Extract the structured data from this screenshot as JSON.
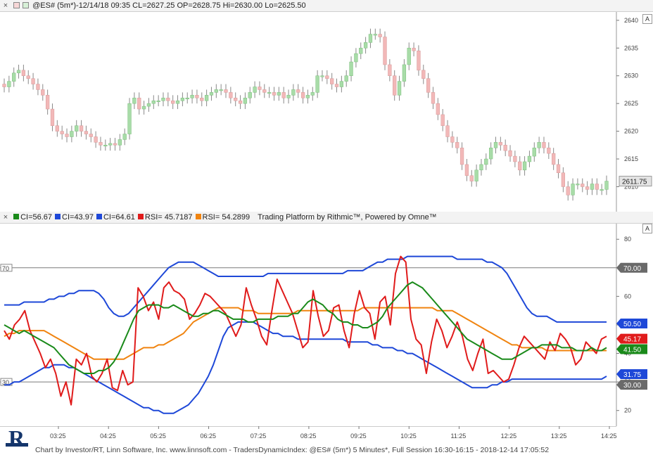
{
  "top_panel": {
    "close_glyph": "×",
    "header_text": "@ES# (5m*)-12/14/18 09:35 CL=2627.25 OP=2628.75 Hi=2630.00 Lo=2625.50",
    "autoscale_label": "A",
    "price_ticks": [
      "2640",
      "2635",
      "2630",
      "2625",
      "2620",
      "2615",
      "2610"
    ],
    "last_price_label": "2611.75"
  },
  "lower_panel": {
    "close_glyph": "×",
    "legend": [
      {
        "text": "CI=56.67",
        "color": "#1a8a1a"
      },
      {
        "text": "CI=43.97",
        "color": "#1e48d8"
      },
      {
        "text": "CI=64.61",
        "color": "#1e48d8"
      },
      {
        "text": "RSI= 45.7187",
        "color": "#e01b1b"
      },
      {
        "text": "RSI= 54.2899",
        "color": "#f08410"
      }
    ],
    "legend_tail": "Trading Platform by Rithmic™, Powered by Omne™",
    "autoscale_label": "A",
    "ticks": [
      "80",
      "70",
      "60",
      "50",
      "40",
      "30",
      "20"
    ],
    "left_level_70": "70",
    "left_level_30": "30",
    "value_tags": [
      {
        "text": "70.00",
        "color": "#6a6a6a"
      },
      {
        "text": "50.50",
        "color": "#1e48d8"
      },
      {
        "text": "45.17",
        "color": "#e01b1b"
      },
      {
        "text": "41.50",
        "color": "#1a8a1a"
      },
      {
        "text": "31.75",
        "color": "#1e48d8"
      },
      {
        "text": "30.00",
        "color": "#6a6a6a"
      }
    ]
  },
  "time_axis": [
    "03:25",
    "04:25",
    "05:25",
    "06:25",
    "07:25",
    "08:25",
    "09:25",
    "10:25",
    "11:25",
    "12:25",
    "13:25",
    "14:25"
  ],
  "footer": "Chart by Investor/RT, Linn Software, Inc. www.linnsoft.com - TradersDynamicIndex: @ES# (5m*) 5 Minutes*, Full Session 16:30-16:15 - 2018-12-14 17:05:52",
  "logo_letter": "R",
  "colors": {
    "bull": "#a8dca8",
    "bear": "#f2b8b8",
    "wick": "#8a8a8a",
    "rsi": "#e01b1b",
    "signal": "#1a8a1a",
    "bands": "#1e48d8",
    "base": "#f08410"
  },
  "chart_data": [
    {
      "type": "candlestick",
      "title": "@ES# (5m*)",
      "ylim": [
        2606,
        2641
      ],
      "close": [
        2628.0,
        2629.0,
        2630.5,
        2631.0,
        2630.0,
        2629.5,
        2628.5,
        2627.5,
        2626.5,
        2624.0,
        2621.0,
        2620.0,
        2619.5,
        2619.0,
        2620.0,
        2621.0,
        2620.0,
        2619.5,
        2619.0,
        2618.0,
        2617.5,
        2617.5,
        2617.8,
        2617.5,
        2618.5,
        2619.5,
        2625.0,
        2626.0,
        2624.0,
        2624.5,
        2625.0,
        2625.5,
        2625.5,
        2626.0,
        2625.5,
        2625.0,
        2625.5,
        2626.0,
        2626.0,
        2626.5,
        2626.0,
        2625.5,
        2626.5,
        2627.0,
        2627.5,
        2627.5,
        2627.0,
        2626.0,
        2625.5,
        2625.0,
        2626.0,
        2627.0,
        2628.0,
        2627.5,
        2627.0,
        2627.0,
        2626.5,
        2627.0,
        2626.0,
        2626.5,
        2627.5,
        2627.0,
        2626.0,
        2626.5,
        2627.0,
        2630.0,
        2630.0,
        2629.5,
        2628.5,
        2628.0,
        2629.0,
        2630.0,
        2632.5,
        2634.0,
        2635.0,
        2636.0,
        2637.5,
        2637.5,
        2637.0,
        2632.0,
        2630.0,
        2626.5,
        2629.0,
        2632.0,
        2635.0,
        2634.5,
        2631.0,
        2629.5,
        2627.0,
        2625.0,
        2623.0,
        2621.0,
        2619.0,
        2618.0,
        2617.0,
        2614.0,
        2612.0,
        2611.0,
        2613.0,
        2614.0,
        2615.0,
        2617.0,
        2618.0,
        2617.5,
        2616.5,
        2615.5,
        2614.5,
        2613.0,
        2614.5,
        2615.5,
        2617.0,
        2618.0,
        2617.0,
        2616.0,
        2614.0,
        2612.5,
        2610.0,
        2608.5,
        2610.5,
        2610.5,
        2610.0,
        2609.5,
        2610.5,
        2609.5,
        2609.5,
        2611.0
      ]
    },
    {
      "type": "line",
      "title": "TradersDynamicIndex",
      "ylim": [
        15,
        84
      ],
      "x": [
        "03:25",
        "04:25",
        "05:25",
        "06:25",
        "07:25",
        "08:25",
        "09:25",
        "10:25",
        "11:25",
        "12:25",
        "13:25",
        "14:25"
      ],
      "reference_lines": [
        70,
        30
      ],
      "series": [
        {
          "name": "RSI= 45.7187",
          "color": "#e01b1b",
          "values": [
            48,
            45,
            50,
            52,
            55,
            48,
            44,
            40,
            35,
            38,
            33,
            25,
            30,
            22,
            38,
            36,
            40,
            32,
            30,
            33,
            38,
            28,
            27,
            34,
            29,
            30,
            63,
            60,
            55,
            58,
            52,
            63,
            65,
            62,
            61,
            59,
            52,
            54,
            57,
            61,
            60,
            58,
            56,
            54,
            50,
            46,
            50,
            63,
            57,
            52,
            46,
            43,
            55,
            66,
            62,
            58,
            54,
            48,
            42,
            44,
            62,
            53,
            46,
            48,
            56,
            57,
            48,
            42,
            54,
            62,
            56,
            54,
            45,
            58,
            60,
            50,
            68,
            74,
            72,
            52,
            45,
            43,
            33,
            44,
            52,
            48,
            42,
            46,
            51,
            46,
            38,
            34,
            40,
            45,
            33,
            34,
            32,
            30,
            31,
            36,
            42,
            46,
            44,
            42,
            40,
            38,
            44,
            41,
            47,
            45,
            42,
            36,
            38,
            44,
            42,
            40,
            45,
            46
          ]
        },
        {
          "name": "CI=56.67",
          "color": "#1a8a1a",
          "values": [
            50,
            49,
            48,
            47,
            48,
            47,
            46,
            45,
            44,
            43,
            42,
            40,
            38,
            36,
            35,
            34,
            33,
            33,
            33,
            34,
            34,
            35,
            37,
            40,
            44,
            48,
            52,
            55,
            56,
            57,
            57,
            57,
            56,
            56,
            57,
            56,
            55,
            54,
            53,
            53,
            54,
            54,
            55,
            55,
            54,
            53,
            52,
            52,
            52,
            51,
            51,
            52,
            52,
            52,
            52,
            53,
            53,
            53,
            54,
            54,
            56,
            58,
            59,
            58,
            57,
            55,
            54,
            52,
            51,
            51,
            50,
            50,
            49,
            49,
            50,
            51,
            53,
            56,
            58,
            60,
            62,
            64,
            65,
            64,
            63,
            61,
            59,
            57,
            55,
            53,
            51,
            49,
            47,
            45,
            44,
            43,
            42,
            41,
            40,
            39,
            38,
            38,
            38,
            39,
            40,
            41,
            42,
            42,
            43,
            43,
            43,
            43,
            42,
            42,
            42,
            41,
            41,
            41,
            42,
            41,
            41,
            42
          ]
        },
        {
          "name": "CI=43.97",
          "color": "#1e48d8",
          "values": [
            29,
            29,
            30,
            30,
            31,
            32,
            33,
            34,
            35,
            35,
            36,
            36,
            36,
            35,
            35,
            34,
            33,
            32,
            31,
            30,
            29,
            28,
            27,
            26,
            25,
            24,
            23,
            22,
            21,
            21,
            20,
            20,
            19,
            19,
            19,
            20,
            21,
            22,
            24,
            26,
            29,
            32,
            36,
            41,
            46,
            49,
            50,
            51,
            51,
            51,
            51,
            50,
            49,
            48,
            47,
            47,
            46,
            46,
            46,
            45,
            45,
            45,
            45,
            45,
            45,
            45,
            45,
            45,
            45,
            44,
            44,
            44,
            44,
            44,
            43,
            43,
            42,
            42,
            42,
            41,
            41,
            40,
            40,
            39,
            38,
            37,
            36,
            35,
            34,
            33,
            32,
            31,
            30,
            29,
            28,
            28,
            28,
            28,
            29,
            29,
            30,
            30,
            31,
            31,
            31,
            31,
            31,
            31,
            31,
            31,
            31,
            31,
            31,
            31,
            31,
            31,
            31,
            31,
            31,
            31,
            31,
            32
          ]
        },
        {
          "name": "CI=64.61",
          "color": "#1e48d8",
          "values": [
            57,
            57,
            57,
            57,
            58,
            58,
            58,
            58,
            58,
            59,
            59,
            60,
            60,
            61,
            61,
            62,
            62,
            62,
            62,
            61,
            59,
            56,
            54,
            53,
            53,
            54,
            56,
            58,
            60,
            62,
            64,
            66,
            68,
            70,
            71,
            72,
            72,
            72,
            72,
            71,
            70,
            69,
            68,
            67,
            67,
            67,
            67,
            67,
            67,
            67,
            67,
            67,
            67,
            68,
            68,
            68,
            68,
            68,
            68,
            68,
            68,
            68,
            68,
            68,
            68,
            68,
            68,
            68,
            68,
            69,
            69,
            69,
            69,
            70,
            71,
            72,
            72,
            73,
            73,
            73,
            73,
            74,
            74,
            74,
            74,
            74,
            74,
            74,
            74,
            74,
            74,
            73,
            73,
            73,
            73,
            73,
            73,
            72,
            72,
            71,
            70,
            68,
            65,
            62,
            59,
            56,
            54,
            53,
            53,
            53,
            52,
            51,
            51,
            51,
            51,
            51,
            51,
            51,
            51,
            51,
            51,
            51
          ]
        },
        {
          "name": "RSI= 54.2899",
          "color": "#f08410",
          "values": [
            46,
            47,
            47,
            48,
            48,
            48,
            48,
            48,
            48,
            47,
            46,
            45,
            44,
            43,
            42,
            41,
            40,
            39,
            38,
            38,
            38,
            38,
            38,
            38,
            38,
            39,
            40,
            41,
            42,
            42,
            42,
            43,
            43,
            44,
            45,
            46,
            47,
            49,
            51,
            52,
            53,
            54,
            55,
            56,
            56,
            56,
            56,
            56,
            55,
            55,
            55,
            54,
            54,
            54,
            54,
            54,
            54,
            54,
            54,
            55,
            55,
            55,
            55,
            55,
            55,
            55,
            55,
            55,
            55,
            55,
            55,
            55,
            56,
            56,
            56,
            56,
            56,
            56,
            56,
            56,
            56,
            56,
            56,
            56,
            56,
            56,
            56,
            55,
            55,
            55,
            55,
            54,
            53,
            52,
            51,
            50,
            49,
            48,
            47,
            46,
            45,
            44,
            43,
            43,
            42,
            42,
            42,
            42,
            42,
            41,
            41,
            41,
            41,
            41,
            41,
            41,
            41,
            41,
            41,
            41,
            41,
            41
          ]
        }
      ]
    }
  ]
}
